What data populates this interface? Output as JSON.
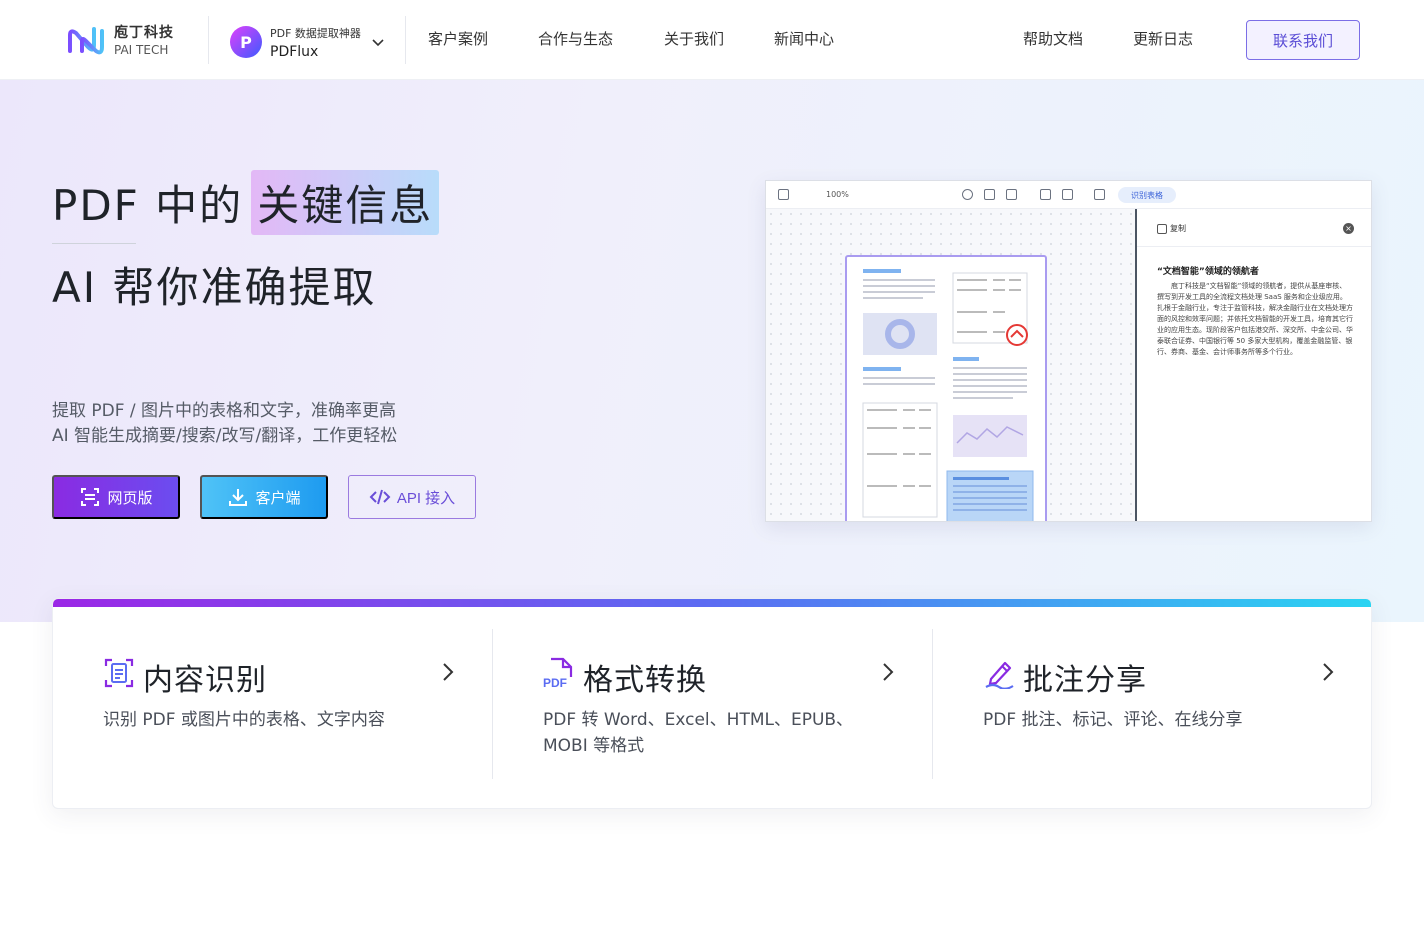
{
  "nav": {
    "logo": {
      "cn": "庖丁科技",
      "en": "PAI TECH"
    },
    "product": {
      "badge": "P",
      "tagline": "PDF 数据提取神器",
      "name": "PDFlux"
    },
    "links": [
      "客户案例",
      "合作与生态",
      "关于我们",
      "新闻中心"
    ],
    "right_links": [
      "帮助文档",
      "更新日志"
    ],
    "cta": "联系我们"
  },
  "hero": {
    "line1_prefix": "PDF 中的",
    "line1_highlight": "关键信息",
    "line2": "AI 帮你准确提取",
    "sub1": "提取 PDF / 图片中的表格和文字，准确率更高",
    "sub2": "AI 智能生成摘要/搜索/改写/翻译，工作更轻松",
    "buttons": {
      "web": "网页版",
      "client": "客户端",
      "api": "API 接入"
    }
  },
  "mockup": {
    "zoom": "100%",
    "recognize_table": "识别表格",
    "copy": "复制",
    "title": "“文档智能”领域的领航者",
    "body": "庖丁科技是“文档智能”领域的领航者，提供从基座审核、撰写到开发工具的全流程文档处理 SaaS 服务和企业级应用。扎根于金融行业，专注于监管科技，解决金融行业在文档处理方面的风控和效率问题；并依托文档智能的开发工具，培育其它行业的应用生态。现阶段客户包括港交所、深交所、中金公司、华泰联合证券、中国银行等 50 多家大型机构，覆盖金融监管、银行、券商、基金、会计师事务所等多个行业。"
  },
  "features": [
    {
      "title": "内容识别",
      "desc": "识别 PDF 或图片中的表格、文字内容",
      "icon": "scan-doc-icon"
    },
    {
      "title": "格式转换",
      "desc": "PDF 转 Word、Excel、HTML、EPUB、MOBI 等格式",
      "icon": "pdf-file-icon"
    },
    {
      "title": "批注分享",
      "desc": "PDF 批注、标记、评论、在线分享",
      "icon": "pen-annotate-icon"
    }
  ],
  "colors": {
    "accent": "#7b6ee6",
    "purple": "#8a2be2",
    "blue": "#1e9bf0"
  }
}
